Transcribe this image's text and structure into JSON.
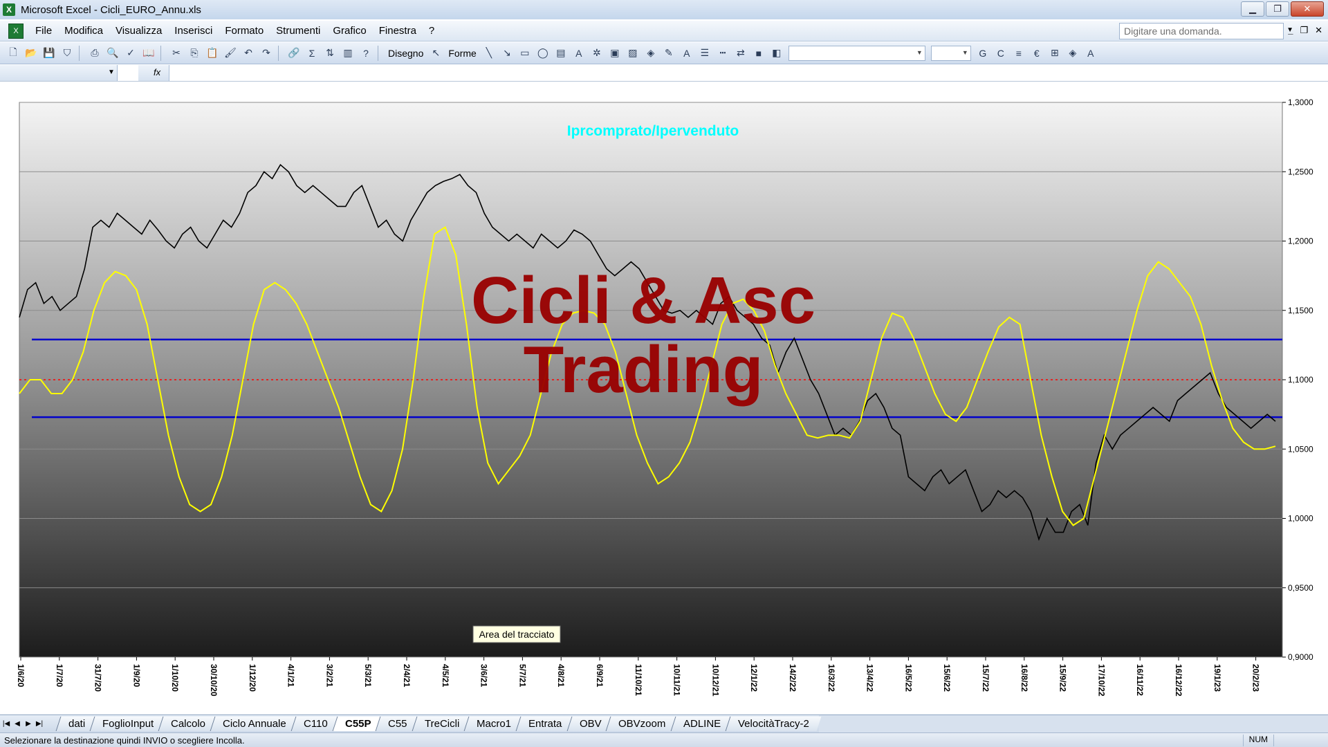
{
  "window": {
    "title": "Microsoft Excel - Cicli_EURO_Annu.xls"
  },
  "menu": [
    "File",
    "Modifica",
    "Visualizza",
    "Inserisci",
    "Formato",
    "Strumenti",
    "Grafico",
    "Finestra",
    "?"
  ],
  "ask_box": {
    "placeholder": "Digitare una domanda."
  },
  "toolbar": {
    "draw_label": "Disegno",
    "shapes_label": "Forme"
  },
  "formula_bar": {
    "fx": "fx"
  },
  "chart_data": {
    "type": "line",
    "title": "Iprcomprato/Ipervenduto",
    "watermark_line1": "Cicli & Asc",
    "watermark_line2": "Trading",
    "tooltip": "Area del tracciato",
    "ylim": [
      0.9,
      1.3
    ],
    "y_ticks": [
      "1,3000",
      "1,2500",
      "1,2000",
      "1,1500",
      "1,1000",
      "1,0500",
      "1,0000",
      "0,9500",
      "0,9000"
    ],
    "y_tick_values": [
      1.3,
      1.25,
      1.2,
      1.15,
      1.1,
      1.05,
      1.0,
      0.95,
      0.9
    ],
    "x_tick_labels": [
      "1/6/20",
      "1/7/20",
      "31/7/20",
      "1/9/20",
      "1/10/20",
      "30/10/20",
      "1/12/20",
      "4/1/21",
      "3/2/21",
      "5/3/21",
      "2/4/21",
      "4/5/21",
      "3/6/21",
      "5/7/21",
      "4/8/21",
      "6/9/21",
      "11/10/21",
      "10/11/21",
      "10/12/21",
      "12/1/22",
      "14/2/22",
      "16/3/22",
      "13/4/22",
      "16/5/22",
      "15/6/22",
      "15/7/22",
      "16/8/22",
      "15/9/22",
      "17/10/22",
      "16/11/22",
      "16/12/22",
      "19/1/23",
      "20/2/23"
    ],
    "hlines": [
      {
        "value": 1.129,
        "color": "#0000cc",
        "style": "solid"
      },
      {
        "value": 1.1,
        "color": "#ff0000",
        "style": "dotted"
      },
      {
        "value": 1.073,
        "color": "#0000cc",
        "style": "solid"
      }
    ],
    "series": [
      {
        "color": "#000000",
        "values": [
          1.145,
          1.165,
          1.17,
          1.155,
          1.16,
          1.15,
          1.155,
          1.16,
          1.18,
          1.21,
          1.215,
          1.21,
          1.22,
          1.215,
          1.21,
          1.205,
          1.215,
          1.208,
          1.2,
          1.195,
          1.205,
          1.21,
          1.2,
          1.195,
          1.205,
          1.215,
          1.21,
          1.22,
          1.235,
          1.24,
          1.25,
          1.245,
          1.255,
          1.25,
          1.24,
          1.235,
          1.24,
          1.235,
          1.23,
          1.225,
          1.225,
          1.235,
          1.24,
          1.225,
          1.21,
          1.215,
          1.205,
          1.2,
          1.215,
          1.225,
          1.235,
          1.24,
          1.243,
          1.245,
          1.248,
          1.24,
          1.235,
          1.22,
          1.21,
          1.205,
          1.2,
          1.205,
          1.2,
          1.195,
          1.205,
          1.2,
          1.195,
          1.2,
          1.208,
          1.205,
          1.2,
          1.19,
          1.18,
          1.175,
          1.18,
          1.185,
          1.18,
          1.17,
          1.16,
          1.15,
          1.148,
          1.15,
          1.145,
          1.15,
          1.145,
          1.14,
          1.155,
          1.16,
          1.15,
          1.145,
          1.14,
          1.13,
          1.125,
          1.105,
          1.12,
          1.13,
          1.115,
          1.1,
          1.09,
          1.075,
          1.06,
          1.065,
          1.06,
          1.07,
          1.085,
          1.09,
          1.08,
          1.065,
          1.06,
          1.03,
          1.025,
          1.02,
          1.03,
          1.035,
          1.025,
          1.03,
          1.035,
          1.02,
          1.005,
          1.01,
          1.02,
          1.015,
          1.02,
          1.015,
          1.005,
          0.985,
          1.0,
          0.99,
          0.99,
          1.005,
          1.01,
          0.995,
          1.04,
          1.06,
          1.05,
          1.06,
          1.065,
          1.07,
          1.075,
          1.08,
          1.075,
          1.07,
          1.085,
          1.09,
          1.095,
          1.1,
          1.105,
          1.09,
          1.08,
          1.075,
          1.07,
          1.065,
          1.07,
          1.075,
          1.07
        ]
      },
      {
        "color": "#ffff00",
        "values": [
          1.09,
          1.1,
          1.1,
          1.09,
          1.09,
          1.1,
          1.12,
          1.15,
          1.17,
          1.178,
          1.175,
          1.165,
          1.14,
          1.1,
          1.06,
          1.03,
          1.01,
          1.005,
          1.01,
          1.03,
          1.06,
          1.1,
          1.14,
          1.165,
          1.17,
          1.165,
          1.155,
          1.14,
          1.12,
          1.1,
          1.08,
          1.055,
          1.03,
          1.01,
          1.005,
          1.02,
          1.05,
          1.1,
          1.16,
          1.205,
          1.21,
          1.19,
          1.14,
          1.08,
          1.04,
          1.025,
          1.035,
          1.045,
          1.06,
          1.09,
          1.12,
          1.14,
          1.148,
          1.15,
          1.148,
          1.14,
          1.12,
          1.09,
          1.06,
          1.04,
          1.025,
          1.03,
          1.04,
          1.055,
          1.08,
          1.11,
          1.14,
          1.155,
          1.158,
          1.15,
          1.135,
          1.11,
          1.09,
          1.075,
          1.06,
          1.058,
          1.06,
          1.06,
          1.058,
          1.07,
          1.1,
          1.13,
          1.148,
          1.145,
          1.13,
          1.11,
          1.09,
          1.075,
          1.07,
          1.08,
          1.1,
          1.12,
          1.138,
          1.145,
          1.14,
          1.1,
          1.06,
          1.03,
          1.005,
          0.995,
          1.0,
          1.03,
          1.06,
          1.09,
          1.12,
          1.15,
          1.175,
          1.185,
          1.18,
          1.17,
          1.16,
          1.14,
          1.11,
          1.085,
          1.065,
          1.055,
          1.05,
          1.05,
          1.052
        ]
      }
    ]
  },
  "sheet_tabs": [
    {
      "label": "dati"
    },
    {
      "label": "FoglioInput"
    },
    {
      "label": "Calcolo"
    },
    {
      "label": "Ciclo Annuale"
    },
    {
      "label": "C110"
    },
    {
      "label": "C55P"
    },
    {
      "label": "C55"
    },
    {
      "label": "TreCicli"
    },
    {
      "label": "Macro1"
    },
    {
      "label": "Entrata"
    },
    {
      "label": "OBV"
    },
    {
      "label": "OBVzoom"
    },
    {
      "label": "ADLINE"
    },
    {
      "label": "VelocitàTracy-2"
    }
  ],
  "status": {
    "message": "Selezionare la destinazione quindi INVIO o scegliere Incolla.",
    "num": "NUM"
  }
}
